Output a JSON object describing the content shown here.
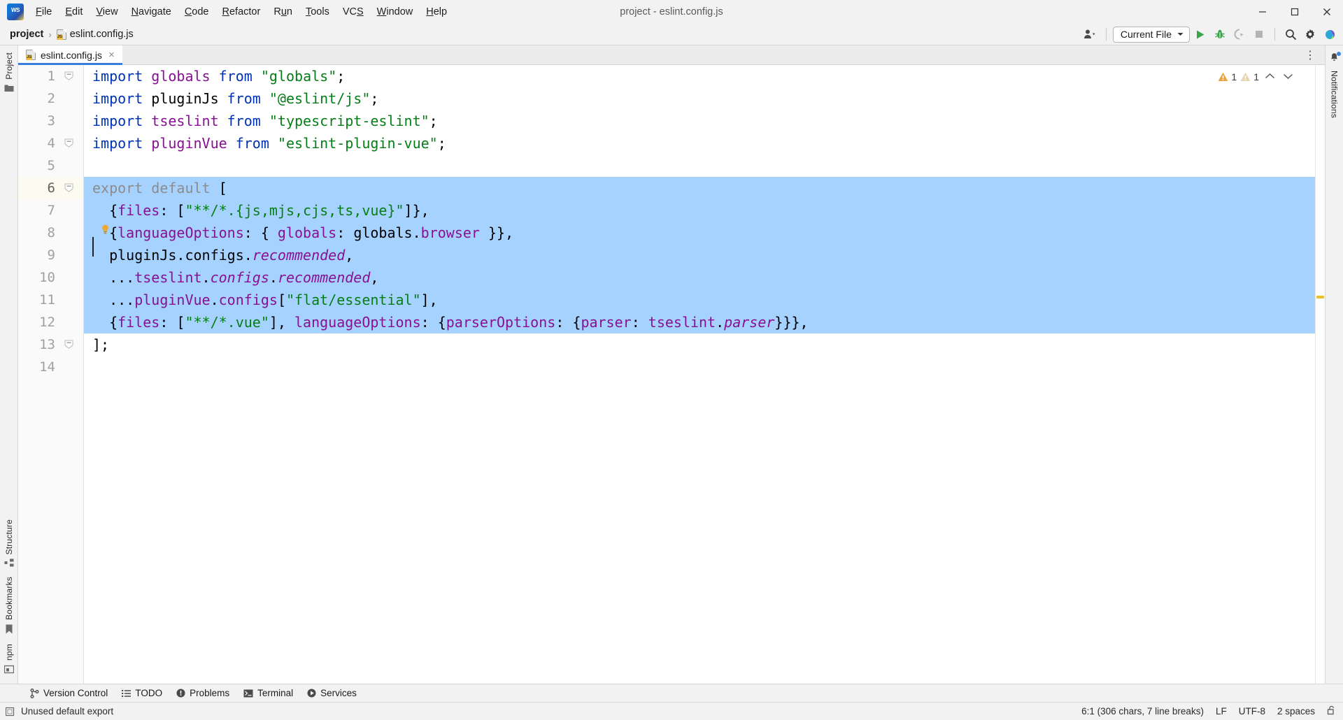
{
  "window": {
    "title": "project - eslint.config.js",
    "app_icon": "webstorm-logo"
  },
  "menu": [
    {
      "label": "File",
      "mnemonic": "F"
    },
    {
      "label": "Edit",
      "mnemonic": "E"
    },
    {
      "label": "View",
      "mnemonic": "V"
    },
    {
      "label": "Navigate",
      "mnemonic": "N"
    },
    {
      "label": "Code",
      "mnemonic": "C"
    },
    {
      "label": "Refactor",
      "mnemonic": "R"
    },
    {
      "label": "Run",
      "mnemonic": "u"
    },
    {
      "label": "Tools",
      "mnemonic": "T"
    },
    {
      "label": "VCS",
      "mnemonic": "S"
    },
    {
      "label": "Window",
      "mnemonic": "W"
    },
    {
      "label": "Help",
      "mnemonic": "H"
    }
  ],
  "window_buttons": {
    "minimize": "minimize-icon",
    "maximize": "maximize-icon",
    "close": "close-icon"
  },
  "breadcrumb": {
    "project": "project",
    "separator": "›",
    "file": "eslint.config.js",
    "file_icon": "js-file-icon"
  },
  "toolbar": {
    "account_label": "account-icon",
    "run_config": "Current File",
    "run_config_chevron": "chevron-down-icon",
    "buttons": [
      {
        "name": "run-button",
        "icon": "play-icon"
      },
      {
        "name": "debug-button",
        "icon": "bug-icon"
      },
      {
        "name": "run-with-coverage-button",
        "icon": "coverage-icon"
      },
      {
        "name": "stop-button",
        "icon": "stop-icon"
      },
      {
        "name": "search-everywhere-button",
        "icon": "search-icon"
      },
      {
        "name": "settings-button",
        "icon": "gear-icon"
      },
      {
        "name": "ai-assistant-button",
        "icon": "ai-assistant-icon"
      }
    ]
  },
  "left_rail": [
    {
      "label": "Project",
      "icon": "folder-icon"
    },
    {
      "label": "Structure",
      "icon": "structure-icon"
    },
    {
      "label": "Bookmarks",
      "icon": "bookmark-icon"
    },
    {
      "label": "npm",
      "icon": "npm-icon"
    }
  ],
  "right_rail": [
    {
      "label": "Notifications",
      "icon": "bell-icon",
      "badge": true
    }
  ],
  "tabs": [
    {
      "label": "eslint.config.js",
      "icon": "js-file-icon",
      "active": true,
      "close": "×"
    }
  ],
  "tabs_actions": {
    "more": "⋮"
  },
  "inspections": {
    "warning_icon": "warning-triangle-icon",
    "warning_count": "1",
    "weak_warning_icon": "weak-warning-triangle-icon",
    "weak_warning_count": "1",
    "prev_icon": "chevron-up-icon",
    "next_icon": "chevron-down-icon"
  },
  "editor": {
    "line_numbers": [
      "1",
      "2",
      "3",
      "4",
      "5",
      "6",
      "7",
      "8",
      "9",
      "10",
      "11",
      "12",
      "13",
      "14"
    ],
    "current_line": 6,
    "selection_lines": [
      6,
      12
    ],
    "intention_bulb": "lightbulb-icon",
    "fold_lines": [
      1,
      4,
      6,
      13
    ],
    "lines": [
      {
        "n": 1,
        "tokens": [
          {
            "t": "import",
            "c": "k"
          },
          {
            "t": " ",
            "c": "pl"
          },
          {
            "t": "globals",
            "c": "id"
          },
          {
            "t": " ",
            "c": "pl"
          },
          {
            "t": "from",
            "c": "k"
          },
          {
            "t": " ",
            "c": "pl"
          },
          {
            "t": "\"globals\"",
            "c": "s"
          },
          {
            "t": ";",
            "c": "pl"
          }
        ]
      },
      {
        "n": 2,
        "tokens": [
          {
            "t": "import",
            "c": "k"
          },
          {
            "t": " ",
            "c": "pl"
          },
          {
            "t": "pluginJs",
            "c": "pl"
          },
          {
            "t": " ",
            "c": "pl"
          },
          {
            "t": "from",
            "c": "k"
          },
          {
            "t": " ",
            "c": "pl"
          },
          {
            "t": "\"@eslint/js\"",
            "c": "s"
          },
          {
            "t": ";",
            "c": "pl"
          }
        ]
      },
      {
        "n": 3,
        "tokens": [
          {
            "t": "import",
            "c": "k"
          },
          {
            "t": " ",
            "c": "pl"
          },
          {
            "t": "tseslint",
            "c": "id"
          },
          {
            "t": " ",
            "c": "pl"
          },
          {
            "t": "from",
            "c": "k"
          },
          {
            "t": " ",
            "c": "pl"
          },
          {
            "t": "\"typescript-eslint\"",
            "c": "s"
          },
          {
            "t": ";",
            "c": "pl"
          }
        ]
      },
      {
        "n": 4,
        "tokens": [
          {
            "t": "import",
            "c": "k"
          },
          {
            "t": " ",
            "c": "pl"
          },
          {
            "t": "pluginVue",
            "c": "id"
          },
          {
            "t": " ",
            "c": "pl"
          },
          {
            "t": "from",
            "c": "k"
          },
          {
            "t": " ",
            "c": "pl"
          },
          {
            "t": "\"eslint-plugin-vue\"",
            "c": "s"
          },
          {
            "t": ";",
            "c": "pl"
          }
        ]
      },
      {
        "n": 5,
        "tokens": []
      },
      {
        "n": 6,
        "tokens": [
          {
            "t": "export default",
            "c": "gy"
          },
          {
            "t": " [",
            "c": "pl"
          }
        ]
      },
      {
        "n": 7,
        "tokens": [
          {
            "t": "  {",
            "c": "pl"
          },
          {
            "t": "files",
            "c": "id"
          },
          {
            "t": ": [",
            "c": "pl"
          },
          {
            "t": "\"**/*.{js,mjs,cjs,ts,vue}\"",
            "c": "s"
          },
          {
            "t": "]},",
            "c": "pl"
          }
        ]
      },
      {
        "n": 8,
        "tokens": [
          {
            "t": "  {",
            "c": "pl"
          },
          {
            "t": "languageOptions",
            "c": "id"
          },
          {
            "t": ": { ",
            "c": "pl"
          },
          {
            "t": "globals",
            "c": "id"
          },
          {
            "t": ": ",
            "c": "pl"
          },
          {
            "t": "globals",
            "c": "pl"
          },
          {
            "t": ".",
            "c": "pl"
          },
          {
            "t": "browser",
            "c": "id"
          },
          {
            "t": " }},",
            "c": "pl"
          }
        ]
      },
      {
        "n": 9,
        "tokens": [
          {
            "t": "  pluginJs",
            "c": "pl"
          },
          {
            "t": ".",
            "c": "pl"
          },
          {
            "t": "configs",
            "c": "pl"
          },
          {
            "t": ".",
            "c": "pl"
          },
          {
            "t": "recommended",
            "c": "id it"
          },
          {
            "t": ",",
            "c": "pl"
          }
        ]
      },
      {
        "n": 10,
        "tokens": [
          {
            "t": "  ...",
            "c": "pl"
          },
          {
            "t": "tseslint",
            "c": "id"
          },
          {
            "t": ".",
            "c": "pl"
          },
          {
            "t": "configs",
            "c": "id it"
          },
          {
            "t": ".",
            "c": "pl"
          },
          {
            "t": "recommended",
            "c": "id it"
          },
          {
            "t": ",",
            "c": "pl"
          }
        ]
      },
      {
        "n": 11,
        "tokens": [
          {
            "t": "  ...",
            "c": "pl"
          },
          {
            "t": "pluginVue",
            "c": "id"
          },
          {
            "t": ".",
            "c": "pl"
          },
          {
            "t": "configs",
            "c": "id"
          },
          {
            "t": "[",
            "c": "pl"
          },
          {
            "t": "\"flat/essential\"",
            "c": "s"
          },
          {
            "t": "],",
            "c": "pl"
          }
        ]
      },
      {
        "n": 12,
        "tokens": [
          {
            "t": "  {",
            "c": "pl"
          },
          {
            "t": "files",
            "c": "id"
          },
          {
            "t": ": [",
            "c": "pl"
          },
          {
            "t": "\"**/*.vue\"",
            "c": "s"
          },
          {
            "t": "], ",
            "c": "pl"
          },
          {
            "t": "languageOptions",
            "c": "id"
          },
          {
            "t": ": {",
            "c": "pl"
          },
          {
            "t": "parserOptions",
            "c": "id"
          },
          {
            "t": ": {",
            "c": "pl"
          },
          {
            "t": "parser",
            "c": "id"
          },
          {
            "t": ": ",
            "c": "pl"
          },
          {
            "t": "tseslint",
            "c": "id"
          },
          {
            "t": ".",
            "c": "pl"
          },
          {
            "t": "parser",
            "c": "id it"
          },
          {
            "t": "}}},",
            "c": "pl"
          }
        ]
      },
      {
        "n": 13,
        "tokens": [
          {
            "t": "];",
            "c": "pl"
          }
        ]
      },
      {
        "n": 14,
        "tokens": []
      }
    ]
  },
  "bottom_bar": [
    {
      "label": "Version Control",
      "icon": "branch-icon"
    },
    {
      "label": "TODO",
      "icon": "todo-list-icon"
    },
    {
      "label": "Problems",
      "icon": "problems-icon"
    },
    {
      "label": "Terminal",
      "icon": "terminal-icon"
    },
    {
      "label": "Services",
      "icon": "services-icon"
    }
  ],
  "status_bar": {
    "message_icon": "inspection-widget-icon",
    "message": "Unused default export",
    "caret_position": "6:1 (306 chars, 7 line breaks)",
    "line_separator": "LF",
    "encoding": "UTF-8",
    "indent": "2 spaces",
    "lock_icon": "unlocked-icon"
  },
  "colors": {
    "accent": "#3c7ddb",
    "selection": "#a6d2ff",
    "keyword": "#0033b3",
    "string": "#067d17",
    "identifier": "#871094",
    "greyed": "#8c8c8c",
    "warning": "#e8a33d",
    "chrome": "#f2f2f2"
  }
}
